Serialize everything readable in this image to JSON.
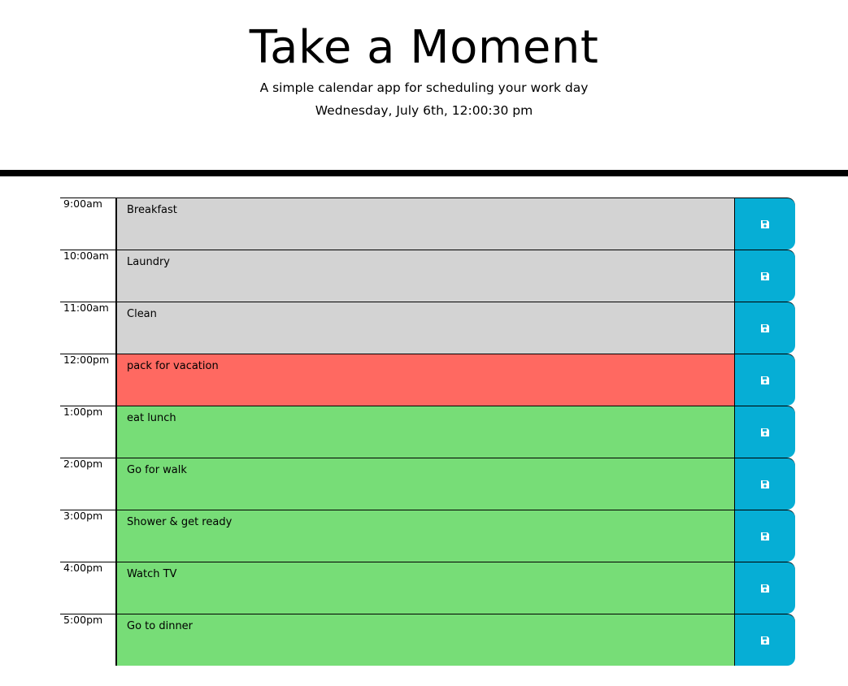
{
  "header": {
    "title": "Take a Moment",
    "lead": "A simple calendar app for scheduling your work day",
    "current_day": "Wednesday, July 6th, 12:00:30 pm"
  },
  "colors": {
    "past": "#d3d3d3",
    "present": "#ff6961",
    "future": "#77dd77",
    "save_button": "#06aed5"
  },
  "time_blocks": [
    {
      "hour": "9:00am",
      "text": "Breakfast",
      "state": "past",
      "icon": "save-icon"
    },
    {
      "hour": "10:00am",
      "text": "Laundry",
      "state": "past",
      "icon": "save-icon"
    },
    {
      "hour": "11:00am",
      "text": "Clean",
      "state": "past",
      "icon": "save-icon"
    },
    {
      "hour": "12:00pm",
      "text": "pack for vacation",
      "state": "present",
      "icon": "save-icon"
    },
    {
      "hour": "1:00pm",
      "text": "eat lunch",
      "state": "future",
      "icon": "save-icon"
    },
    {
      "hour": "2:00pm",
      "text": "Go for walk",
      "state": "future",
      "icon": "save-icon"
    },
    {
      "hour": "3:00pm",
      "text": "Shower & get ready",
      "state": "future",
      "icon": "save-icon"
    },
    {
      "hour": "4:00pm",
      "text": "Watch TV",
      "state": "future",
      "icon": "save-icon"
    },
    {
      "hour": "5:00pm",
      "text": "Go to dinner",
      "state": "future",
      "icon": "save-icon"
    }
  ]
}
